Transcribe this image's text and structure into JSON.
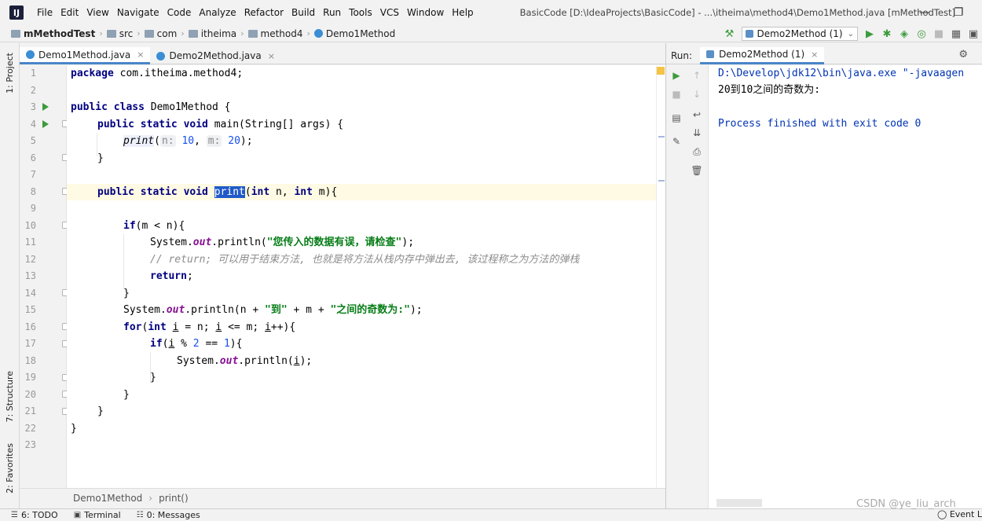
{
  "titlebar": {
    "logo": "IJ",
    "menu": [
      "File",
      "Edit",
      "View",
      "Navigate",
      "Code",
      "Analyze",
      "Refactor",
      "Build",
      "Run",
      "Tools",
      "VCS",
      "Window",
      "Help"
    ],
    "window_title": "BasicCode [D:\\IdeaProjects\\BasicCode] - ...\\itheima\\method4\\Demo1Method.java [mMethodTest]"
  },
  "navbar": {
    "crumbs": [
      "mMethodTest",
      "src",
      "com",
      "itheima",
      "method4",
      "Demo1Method"
    ],
    "run_config": "Demo2Method (1)"
  },
  "left_strip": {
    "tabs": [
      "1: Project",
      "7: Structure",
      "2: Favorites"
    ]
  },
  "editor": {
    "tabs": [
      {
        "label": "Demo1Method.java",
        "active": true
      },
      {
        "label": "Demo2Method.java",
        "active": false
      }
    ],
    "line_numbers": [
      "1",
      "2",
      "3",
      "4",
      "5",
      "6",
      "7",
      "8",
      "9",
      "10",
      "11",
      "12",
      "13",
      "14",
      "15",
      "16",
      "17",
      "18",
      "19",
      "20",
      "21",
      "22",
      "23"
    ],
    "code": {
      "l1_kw": "package",
      "l1_rest": " com.itheima.method4;",
      "l3_kw": "public class",
      "l3_rest": " Demo1Method {",
      "l4_kw": "public static void",
      "l4_rest": " main(String[] args) {",
      "l5_call": "print",
      "l5_p1": "(",
      "l5_h1": "n:",
      "l5_v1": "10",
      "l5_sep": ", ",
      "l5_h2": "m:",
      "l5_v2": "20",
      "l5_end": ");",
      "l6": "}",
      "l8_kw": "public static void",
      "l8_name": "print",
      "l8_p1": "(",
      "l8_int1": "int",
      "l8_n": " n, ",
      "l8_int2": "int",
      "l8_m": " m){",
      "l10_kw": "if",
      "l10_rest": "(m < n){",
      "l11_a": "System.",
      "l11_out": "out",
      "l11_b": ".println(",
      "l11_str": "\"您传入的数据有误，请检查\"",
      "l11_end": ");",
      "l12_comment": "// return; 可以用于结束方法, 也就是将方法从栈内存中弹出去, 该过程称之为方法的弹栈",
      "l13_kw": "return",
      "l13_end": ";",
      "l14": "}",
      "l15_a": "System.",
      "l15_out": "out",
      "l15_b": ".println(n + ",
      "l15_s1": "\"到\"",
      "l15_c": " + m + ",
      "l15_s2": "\"之间的奇数为:\"",
      "l15_end": ");",
      "l16_kw": "for",
      "l16_p": "(",
      "l16_int": "int",
      "l16_sp": " ",
      "l16_i1": "i",
      "l16_b": " = n; ",
      "l16_i2": "i",
      "l16_c": " <= m; ",
      "l16_i3": "i",
      "l16_d": "++){",
      "l17_kw": "if",
      "l17_p": "(",
      "l17_i": "i",
      "l17_b": " % ",
      "l17_n1": "2",
      "l17_c": " == ",
      "l17_n2": "1",
      "l17_d": "){",
      "l18_a": "System.",
      "l18_out": "out",
      "l18_b": ".println(",
      "l18_i": "i",
      "l18_end": ");",
      "l19": "}",
      "l20": "}",
      "l21": "}",
      "l22": "}"
    },
    "breadcrumb": [
      "Demo1Method",
      "print()"
    ]
  },
  "run_panel": {
    "label": "Run:",
    "tab": "Demo2Method (1)",
    "console": [
      {
        "text": "D:\\Develop\\jdk12\\bin\\java.exe \"-javaagen",
        "color": "#0033b3"
      },
      {
        "text": "20到10之间的奇数为:",
        "color": "#000000"
      },
      {
        "text": "",
        "color": "#000000"
      },
      {
        "text": "Process finished with exit code 0",
        "color": "#0033b3"
      }
    ]
  },
  "statusbar": {
    "items": [
      "6: TODO",
      "Terminal",
      "0: Messages"
    ],
    "event_log": "Event Log"
  },
  "watermark": "CSDN @ye_liu_arch",
  "colors": {
    "keyword": "#000080",
    "string": "#067d17",
    "number": "#1750eb",
    "comment": "#8c8c8c",
    "field": "#871094",
    "selection": "#1f5ac8",
    "run_green": "#3c9b3c"
  }
}
